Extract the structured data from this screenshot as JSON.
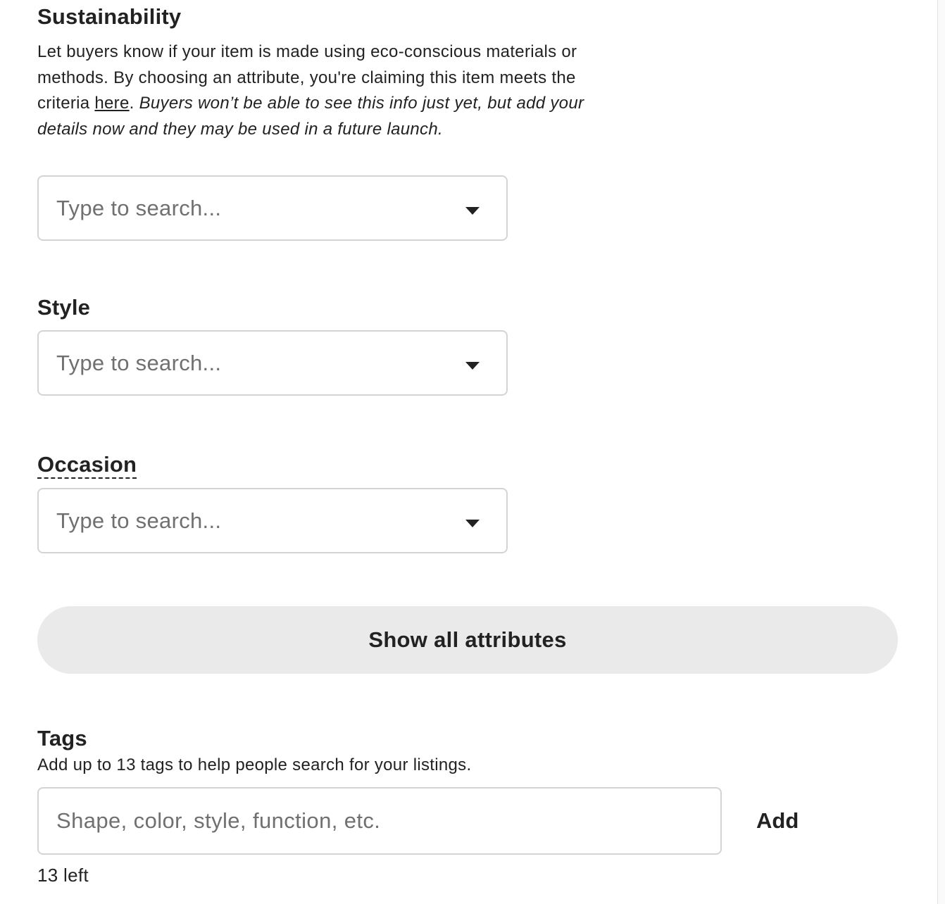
{
  "sustainability": {
    "title": "Sustainability",
    "desc_part1": "Let buyers know if your item is made using eco-conscious materials or methods. By choosing an attribute, you're claiming this item meets the criteria ",
    "link_text": "here",
    "desc_part2": ". ",
    "desc_italic": "Buyers won’t be able to see this info just yet, but add your details now and they may be used in a future launch.",
    "placeholder": "Type to search..."
  },
  "style": {
    "title": "Style",
    "placeholder": "Type to search..."
  },
  "occasion": {
    "title": "Occasion",
    "placeholder": "Type to search..."
  },
  "show_all_label": "Show all attributes",
  "tags": {
    "title": "Tags",
    "description": "Add up to 13 tags to help people search for your listings.",
    "placeholder": "Shape, color, style, function, etc.",
    "add_label": "Add",
    "counter": "13 left"
  },
  "icons": {
    "dropdown": "chevron-down-icon"
  }
}
